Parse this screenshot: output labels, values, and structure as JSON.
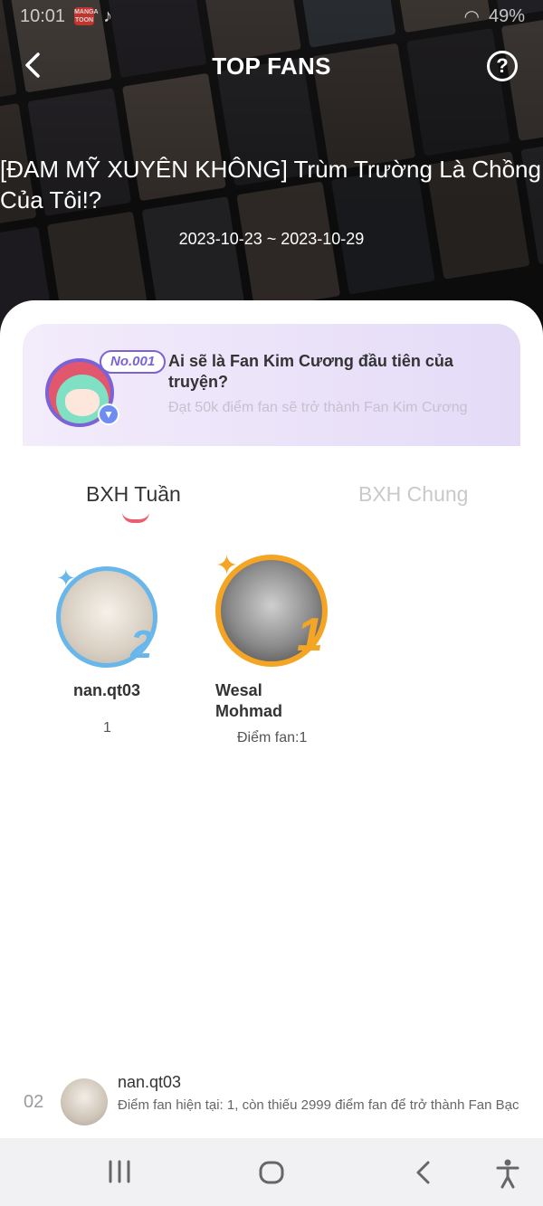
{
  "status_bar": {
    "time": "10:01",
    "app_badge": "MANGA TOON",
    "battery": "49%"
  },
  "header": {
    "title": "TOP FANS",
    "comic_title": "[ĐAM MỸ XUYÊN KHÔNG] Trùm Trường Là Chồng Của Tôi!?",
    "date_range": "2023-10-23 ~ 2023-10-29"
  },
  "banner": {
    "badge": "No.001",
    "title": "Ai sẽ là Fan Kim Cương đầu tiên của truyện?",
    "subtitle": "Đạt 50k điểm fan sẽ trở thành Fan Kim Cương"
  },
  "tabs": [
    {
      "label": "BXH Tuần",
      "active": true
    },
    {
      "label": "BXH Chung",
      "active": false
    }
  ],
  "podium": [
    {
      "rank": "2",
      "name": "nan.qt03",
      "score": "1"
    },
    {
      "rank": "1",
      "name": "Wesal Mohmad",
      "score": "Điểm fan:1"
    }
  ],
  "my_rank": {
    "rank": "02",
    "name": "nan.qt03",
    "description": "Điểm fan hiện tại: 1, còn thiếu 2999 điểm fan để trở thành Fan Bạc"
  },
  "colors": {
    "accent": "#ec5e6f",
    "silver_ring": "#68b6ea",
    "gold_ring": "#f5a524",
    "banner_purple": "#7a62d7"
  }
}
